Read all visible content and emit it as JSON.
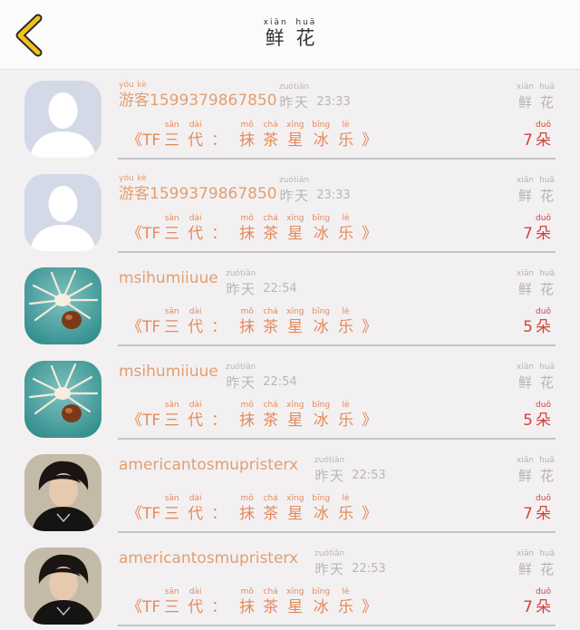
{
  "header": {
    "title_chars": [
      {
        "py": "xiān",
        "hz": "鲜"
      },
      {
        "py": "huā",
        "hz": "花"
      }
    ]
  },
  "labels": {
    "yesterday": [
      {
        "py": "zuó",
        "hz": "昨"
      },
      {
        "py": "tiān",
        "hz": "天"
      }
    ],
    "flower": [
      {
        "py": "xiān",
        "hz": "鲜"
      },
      {
        "py": "huā",
        "hz": "花"
      }
    ],
    "guest": [
      {
        "py": "yóu",
        "hz": "游"
      },
      {
        "py": "kè",
        "hz": "客"
      }
    ],
    "duo": {
      "py": "duǒ",
      "hz": "朵"
    }
  },
  "product": {
    "open": "《TF",
    "san": {
      "py": "sān",
      "hz": "三"
    },
    "dai": {
      "py": "dài",
      "hz": "代"
    },
    "colon": "：",
    "mo": {
      "py": "mǒ",
      "hz": "抹"
    },
    "cha": {
      "py": "chá",
      "hz": "茶"
    },
    "xing": {
      "py": "xīng",
      "hz": "星"
    },
    "bing": {
      "py": "bīng",
      "hz": "冰"
    },
    "le": {
      "py": "lè",
      "hz": "乐"
    },
    "close": "》"
  },
  "rows": [
    {
      "guest": true,
      "name": "1599379867850",
      "time": "23:33",
      "count": "7",
      "avatar": "default"
    },
    {
      "guest": true,
      "name": "1599379867850",
      "time": "23:33",
      "count": "7",
      "avatar": "default"
    },
    {
      "guest": false,
      "name": "msihumiiuue",
      "time": "22:54",
      "count": "5",
      "avatar": "spider"
    },
    {
      "guest": false,
      "name": "msihumiiuue",
      "time": "22:54",
      "count": "5",
      "avatar": "spider"
    },
    {
      "guest": false,
      "name": "americantosmupristerx",
      "time": "22:53",
      "count": "7",
      "avatar": "person"
    },
    {
      "guest": false,
      "name": "americantosmupristerx",
      "time": "22:53",
      "count": "7",
      "avatar": "person"
    }
  ],
  "colors": {
    "username": "#e0a070",
    "product": "#e58a5a",
    "count": "#d2443a",
    "back_arrow": "#f2c21b"
  }
}
